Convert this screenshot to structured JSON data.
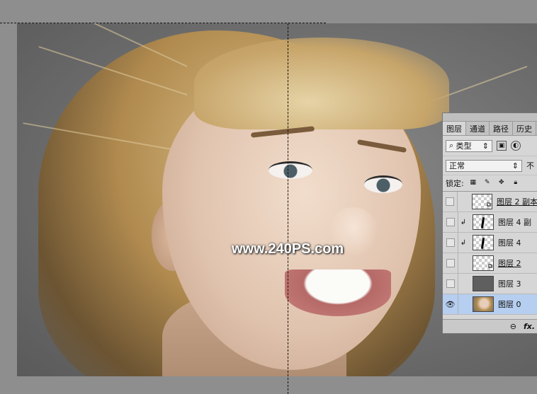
{
  "watermark": {
    "text": "www.240PS.com"
  },
  "layers_panel": {
    "tabs": [
      "图层",
      "通道",
      "路径",
      "历史"
    ],
    "filter": {
      "search_icon": "search-icon",
      "label": "类型",
      "arrows": "⇕"
    },
    "blend_mode": {
      "value": "正常",
      "opacity_label": "不"
    },
    "lock": {
      "label": "锁定:"
    },
    "layers": [
      {
        "name": "图层 2 副本",
        "visible": false,
        "clipped": false,
        "thumb": "smart",
        "selected": false
      },
      {
        "name": "图层 4 副",
        "visible": false,
        "clipped": true,
        "thumb": "mask",
        "selected": false
      },
      {
        "name": "图层 4",
        "visible": false,
        "clipped": true,
        "thumb": "mask",
        "selected": false
      },
      {
        "name": "图层 2",
        "visible": false,
        "clipped": false,
        "thumb": "smart",
        "selected": false
      },
      {
        "name": "图层 3",
        "visible": false,
        "clipped": false,
        "thumb": "dark",
        "selected": false
      },
      {
        "name": "图层 0",
        "visible": true,
        "clipped": false,
        "thumb": "photo",
        "selected": true
      }
    ],
    "footer": {
      "link_icon": "link-icon",
      "fx_label": "fx."
    }
  },
  "colors": {
    "panel_bg": "#d6d6d6",
    "selected_row": "#b6ceef",
    "canvas_bg": "#8e8e8e"
  }
}
